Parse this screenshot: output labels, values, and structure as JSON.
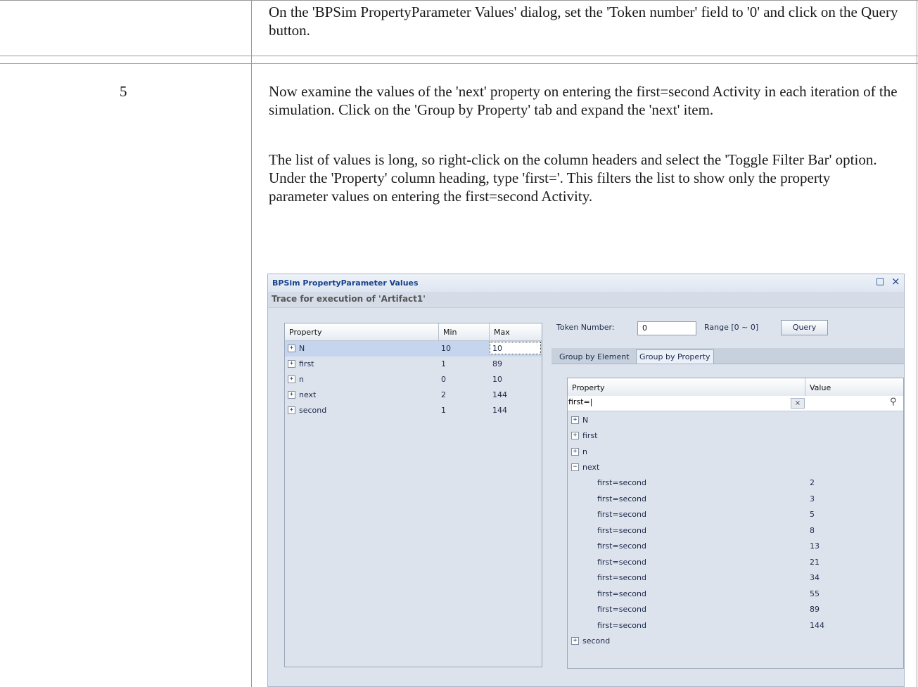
{
  "document": {
    "top_text": "On the 'BPSim PropertyParameter Values' dialog, set the 'Token number' field to '0' and click on the Query button.",
    "step_number": "5",
    "paragraph1": "Now examine the values of the 'next' property on entering the first=second Activity in each iteration of the simulation. Click on the 'Group by Property' tab and expand the 'next' item.",
    "paragraph2": "The list of values is long, so right-click on the column headers and select the 'Toggle Filter Bar' option. Under the 'Property' column heading, type 'first='. This filters the list to show only the property parameter values on entering the first=second Activity."
  },
  "dialog": {
    "title": "BPSim PropertyParameter Values",
    "maximize_icon": "□",
    "close_icon": "×",
    "subtitle": "Trace for execution of 'Artifact1'",
    "left_grid": {
      "headers": [
        "Property",
        "Min",
        "Max"
      ],
      "rows": [
        {
          "property": "N",
          "min": "10",
          "max": "10",
          "expand": "+"
        },
        {
          "property": "first",
          "min": "1",
          "max": "89",
          "expand": "+"
        },
        {
          "property": "n",
          "min": "0",
          "max": "10",
          "expand": "+"
        },
        {
          "property": "next",
          "min": "2",
          "max": "144",
          "expand": "+"
        },
        {
          "property": "second",
          "min": "1",
          "max": "144",
          "expand": "+"
        }
      ]
    },
    "token_label": "Token Number:",
    "token_value": "0",
    "range_label": "Range [0 ~ 0]",
    "query_label": "Query",
    "tabs": [
      "Group by Element",
      "Group by Property"
    ],
    "right_grid": {
      "headers": [
        "Property",
        "Value"
      ],
      "filter_text": "first=|",
      "clear_icon": "×",
      "search_icon": "⚲",
      "groups": [
        {
          "name": "N",
          "expand": "+"
        },
        {
          "name": "first",
          "expand": "+"
        },
        {
          "name": "n",
          "expand": "+"
        },
        {
          "name": "next",
          "expand": "−"
        }
      ],
      "next_items": [
        {
          "property": "first=second",
          "value": "2"
        },
        {
          "property": "first=second",
          "value": "3"
        },
        {
          "property": "first=second",
          "value": "5"
        },
        {
          "property": "first=second",
          "value": "8"
        },
        {
          "property": "first=second",
          "value": "13"
        },
        {
          "property": "first=second",
          "value": "21"
        },
        {
          "property": "first=second",
          "value": "34"
        },
        {
          "property": "first=second",
          "value": "55"
        },
        {
          "property": "first=second",
          "value": "89"
        },
        {
          "property": "first=second",
          "value": "144"
        }
      ],
      "last_group": {
        "name": "second",
        "expand": "+"
      }
    }
  }
}
